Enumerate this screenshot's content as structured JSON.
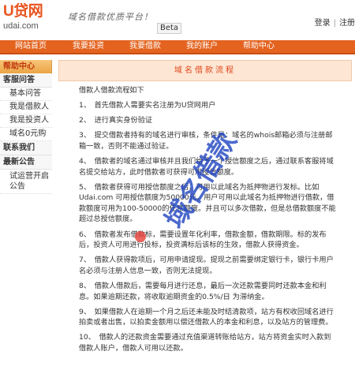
{
  "header": {
    "logo_main": "U贷网",
    "logo_sub": "udai.com",
    "slogan": "域名借款优质平台！",
    "beta": "Beta",
    "login": "登录",
    "separator": "|",
    "register": "注册"
  },
  "nav": {
    "items": [
      "网站首页",
      "我要投资",
      "我要借款",
      "我的账户",
      "帮助中心"
    ]
  },
  "sidebar": {
    "title": "帮助中心",
    "sections": [
      {
        "label": "客服问答",
        "items": [
          "基本问答",
          "我是借款人",
          "我是投资人",
          "域名0元购"
        ]
      },
      {
        "label": "联系我们",
        "items": []
      },
      {
        "label": "最新公告",
        "items": [
          "试运营开启公告"
        ]
      }
    ]
  },
  "main": {
    "title": "域名借款流程",
    "intro": "借款人借款流程如下",
    "steps": [
      "1、　首先借款人需要实名注册为U贷网用户",
      "2、　进行真实身份验证",
      "3、　提交借款者持有的域名进行审核，条件是：域名的whois邮箱必须与注册邮箱一致，否则不能通过验证。",
      "4、　借款者的域名通过审核并且我们给予一个授信额度之后，通过联系客服将域名提交给站方，此时借款者可获得可用授信额度。",
      "5、　借款者获得可用授信额度之后，可用以此域名为抵押物进行发标。比如Udai.com 可用授信额度为50000元，用户可用以此域名为抵押物进行借款，借款额度可用为100-50000的任意额度。并且可以多次借款，但是总借款额度不能超过总授信额度。",
      "6、　借款者发布借款标，需要设置年化利率，借款金额，借款期限。标的发布后，投资人可用进行投标，投资满标后该标的生效，借款人获得资金。",
      "7、　借款人获得款项后，可用申请提现。提现之前需要绑定银行卡，银行卡用户名必须与注册人信息一致，否则无法提现。",
      "8、　借款人借款后，需要每月进行还息，最后一次还款需要同时还款本金和利息。如果逾期还款，将收取逾期资金的0.5%/日 为滞纳金。",
      "9、　如果借款人在逾期一个月之后还未能及时结清款项，站方有权收回域名进行拍卖或者出售，以拍卖金额用以偿还借款人的本金和利息，以及站方的管理费。",
      "10、　借款人的还款资金需要通过充值渠道转账给站方，站方将资金实时入款到借款人账户，借款人可用以还款。"
    ]
  },
  "watermark": {
    "text": "域名借款",
    "color": "#1a3fbf"
  },
  "colors": {
    "brand": "#e3631f",
    "nav_bg": "#e3631f",
    "title_bg": "#fde6d3",
    "title_text": "#e0451b",
    "sidebar_head": "#c0360d"
  }
}
